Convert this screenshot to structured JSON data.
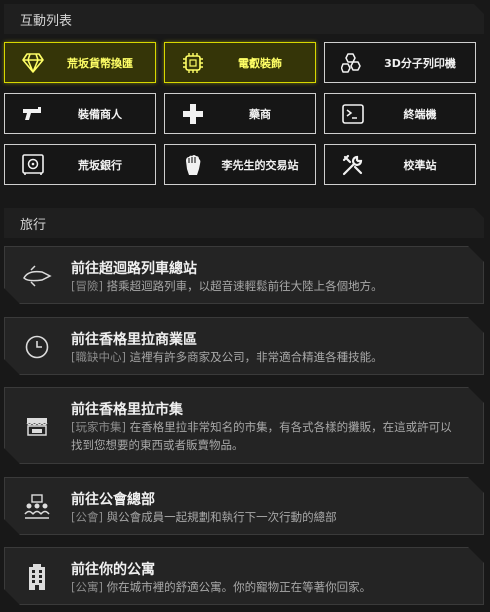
{
  "sections": {
    "interact_title": "互動列表",
    "travel_title": "旅行"
  },
  "colors": {
    "accent": "#d8d800",
    "active_bg": "#353508",
    "border": "#cfcfcf",
    "card_bg": "#242424"
  },
  "interact_buttons": [
    {
      "label": "荒坂貨幣換匯",
      "icon": "diamond-icon",
      "active": true
    },
    {
      "label": "電叡裝飾",
      "icon": "chip-icon",
      "active": true
    },
    {
      "label": "3D分子列印機",
      "icon": "molecule-icon",
      "active": false
    },
    {
      "label": "裝備商人",
      "icon": "gun-icon",
      "active": false
    },
    {
      "label": "藥商",
      "icon": "medical-cross-icon",
      "active": false
    },
    {
      "label": "終端機",
      "icon": "terminal-icon",
      "active": false
    },
    {
      "label": "荒坂銀行",
      "icon": "safe-icon",
      "active": false
    },
    {
      "label": "李先生的交易站",
      "icon": "fist-icon",
      "active": false
    },
    {
      "label": "校準站",
      "icon": "tools-icon",
      "active": false
    }
  ],
  "travel": [
    {
      "title": "前往超迴路列車總站",
      "tag": "[冒險]",
      "desc": " 搭乘超迴路列車，以超音速輕鬆前往大陸上各個地方。",
      "icon": "train-icon"
    },
    {
      "title": "前往香格里拉商業區",
      "tag": "[職缺中心]",
      "desc": " 這裡有許多商家及公司，非常適合精進各種技能。",
      "icon": "clock-icon"
    },
    {
      "title": "前往香格里拉市集",
      "tag": "[玩家市集]",
      "desc": " 在香格里拉非常知名的市集，有各式各樣的攤販，在這或許可以找到您想要的東西或者販賣物品。",
      "icon": "market-stall-icon"
    },
    {
      "title": "前往公會總部",
      "tag": "[公會]",
      "desc": " 與公會成員一起規劃和執行下一次行動的總部",
      "icon": "guild-icon"
    },
    {
      "title": "前往你的公寓",
      "tag": "[公寓]",
      "desc": " 你在城市裡的舒適公寓。你的寵物正在等著你回家。",
      "icon": "apartment-icon"
    }
  ]
}
